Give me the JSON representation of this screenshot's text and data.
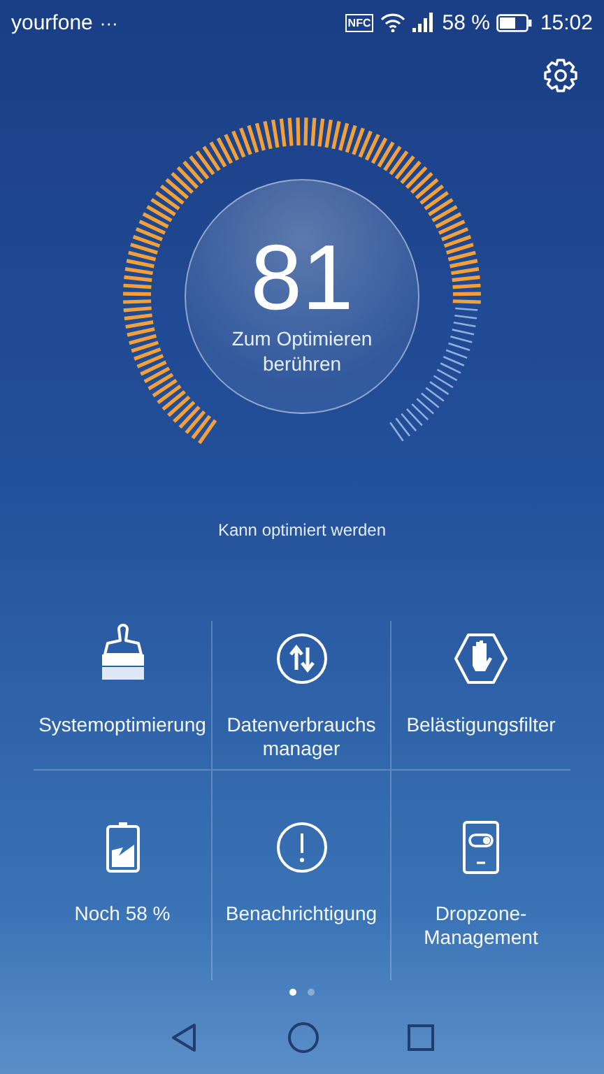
{
  "status_bar": {
    "carrier": "yourfone",
    "more": "···",
    "nfc": "NFC",
    "battery_text": "58 %",
    "time": "15:02"
  },
  "gauge": {
    "score": "81",
    "action": "Zum Optimieren berühren"
  },
  "hint": "Kann optimiert werden",
  "tiles": [
    {
      "kind": "broom",
      "label": "Systemoptimierung"
    },
    {
      "kind": "data",
      "label": "Datenverbrauchs manager"
    },
    {
      "kind": "hand",
      "label": "Belästigungsfilter"
    },
    {
      "kind": "battery",
      "label": "Noch 58 %"
    },
    {
      "kind": "alert",
      "label": "Benachrichtigung"
    },
    {
      "kind": "dropzone",
      "label": "Dropzone-Management"
    }
  ],
  "pages": [
    {
      "selected": true
    },
    {
      "selected": false
    }
  ]
}
